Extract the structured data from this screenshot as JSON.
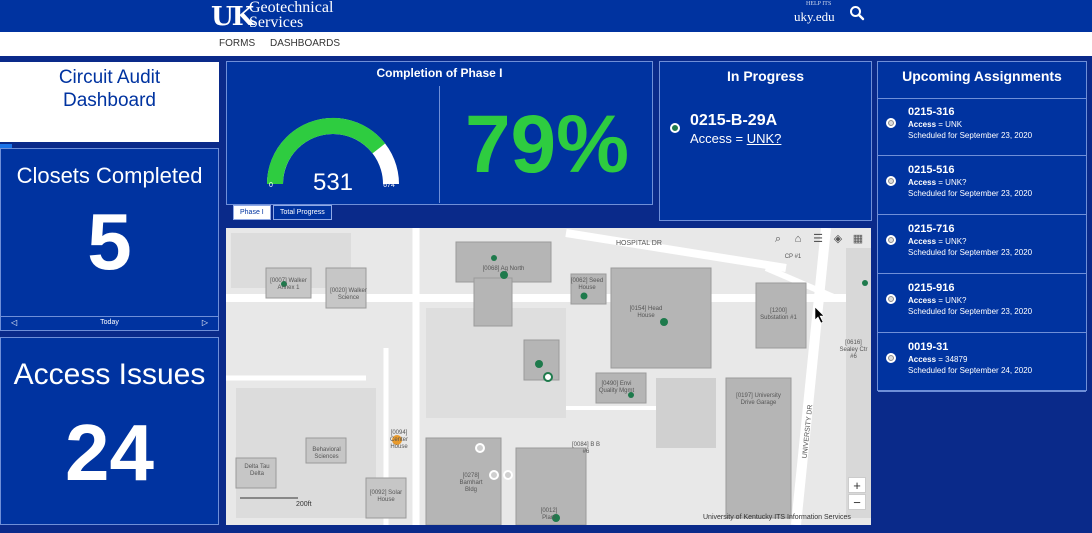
{
  "header": {
    "logo_text": "UK",
    "site_name_line1": "Geotechnical",
    "site_name_line2": "Services",
    "link_small": "HELP ITS",
    "link_text": "uky.edu",
    "search_icon": "search-icon"
  },
  "nav": {
    "items": [
      "FORMS",
      "DASHBOARDS"
    ]
  },
  "dashboard_title": {
    "line1": "Circuit Audit",
    "line2": "Dashboard"
  },
  "closets": {
    "label": "Closets Completed",
    "value": "5",
    "footer": "Today"
  },
  "access": {
    "label": "Access Issues",
    "value": "24"
  },
  "gauge": {
    "title": "Completion of Phase I",
    "value": "531",
    "min": "0",
    "max": "674",
    "fraction": 0.79,
    "percent_text": "79%",
    "color": "#2ecc40",
    "tabs": [
      "Phase I",
      "Total Progress"
    ]
  },
  "in_progress": {
    "title": "In Progress",
    "code": "0215-B-29A",
    "access_label": "Access =",
    "access_value": "UNK?"
  },
  "upcoming": {
    "title": "Upcoming Assignments",
    "items": [
      {
        "code": "0215-316",
        "access_label": "Access",
        "access_value": "= UNK",
        "schedule": "Scheduled for September 23, 2020"
      },
      {
        "code": "0215-516",
        "access_label": "Access",
        "access_value": "= UNK?",
        "schedule": "Scheduled for September 23, 2020"
      },
      {
        "code": "0215-716",
        "access_label": "Access",
        "access_value": "= UNK?",
        "schedule": "Scheduled for September 23, 2020"
      },
      {
        "code": "0215-916",
        "access_label": "Access",
        "access_value": "= UNK?",
        "schedule": "Scheduled for September 23, 2020"
      },
      {
        "code": "0019-31",
        "access_label": "Access",
        "access_value": "= 34879",
        "schedule": "Scheduled for September 24, 2020"
      }
    ]
  },
  "map": {
    "attribution": "University of Kentucky ITS Information Services",
    "scale": "200ft",
    "zoom_in": "+",
    "zoom_out": "−",
    "labels": {
      "hospital_dr": "HOSPITAL DR",
      "university_dr": "UNIVERSITY DR",
      "substation": "[1200] Substation #1",
      "garage": "[0197] University Drive Garage",
      "walker": "[0007] Walker Annex 1",
      "walker2": "[0020] Walker Science",
      "ag_north": "[0068] Ag North",
      "seed_house": "[0062] Seed House",
      "head_house": "[0154] Head House",
      "envi_quality": "[0490] Envi Quality Mgmt",
      "bb86": "[0084] B B #6",
      "barnhart": "[0278] Barnhart Bldg",
      "solar_house": "[0092] Solar House",
      "delta_tau": "Delta Tau Delta",
      "behavioral": "Behavioral Sciences",
      "sealey": "[0616] Sealey Ctr #6",
      "cp81": "CP #1",
      "plant": "[0012] Plant",
      "greenhouse": "[0094] Center House"
    },
    "dot_green": "#1e7a4c",
    "dot_orange": "#e89a2c"
  },
  "colors": {
    "uk_blue": "#0033a0",
    "panel_border": "#6f8fd8",
    "gauge_green": "#2ecc40"
  }
}
